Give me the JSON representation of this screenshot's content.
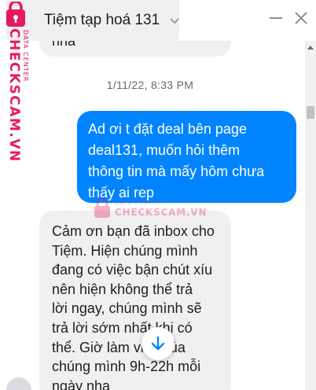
{
  "header": {
    "title": "Tiệm tạp hoá 131"
  },
  "messages": {
    "previous_incoming": "nha",
    "timestamp": "1/11/22, 8:33 PM",
    "outgoing": [
      "Ad ơi t đặt deal bên page",
      "deal131, muốn hỏi thêm",
      "thông tin mà mấy hôm chưa",
      "thấy ai rep"
    ],
    "incoming": [
      "Cảm ơn bạn đã inbox cho",
      "Tiệm. Hiện chúng mình",
      "đang có việc bận chút xíu",
      "nên hiện không thể trả",
      "lời ngay, chúng mình sẽ",
      "trả lời sớm nhất khi có",
      "thể. Giờ làm việc của",
      "chúng mình 9h-22h mỗi",
      "ngày nha"
    ]
  },
  "watermark": {
    "brand": "CHECKSCAM.VN",
    "tagline": "DATA CENTER"
  },
  "colors": {
    "outgoing_bubble": "#0084ff",
    "incoming_bubble": "#f0f0f0",
    "watermark": "#e6195f"
  },
  "icons": {
    "chevron": "chevron-down-icon",
    "minimize": "minimize-icon",
    "close": "close-icon",
    "jump": "arrow-down-icon"
  }
}
